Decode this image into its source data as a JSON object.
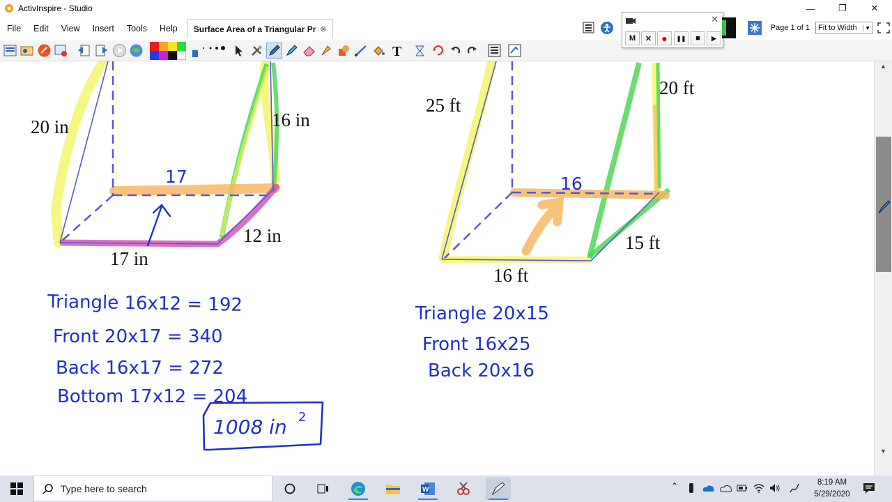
{
  "window": {
    "title": "ActivInspire - Studio",
    "minimize": "—",
    "restore": "❐",
    "close": "✕"
  },
  "menu": {
    "items": [
      "File",
      "Edit",
      "View",
      "Insert",
      "Tools",
      "Help"
    ],
    "doc_tab": "Surface Area of a Triangular Pr",
    "doc_tab_close": "⊗"
  },
  "page_nav": {
    "page": "Page 1 of 1",
    "zoom": "Fit to Width"
  },
  "recorder": {
    "buttons": [
      "M",
      "✕",
      "●",
      "❚❚",
      "■",
      "▶"
    ]
  },
  "figure_left": {
    "labels": {
      "slant": "20 in",
      "height": "16 in",
      "depth": "12 in",
      "base": "17 in"
    },
    "annotation": "17",
    "work": [
      "Triangle  16x12 = 192",
      "Front  20x17 = 340",
      "Back  16x17 = 272",
      "Bottom  17x12 = 204"
    ],
    "answer": "1008 in",
    "answer_exp": "2"
  },
  "figure_right": {
    "labels": {
      "slant": "25 ft",
      "height": "20 ft",
      "depth": "15 ft",
      "base": "16 ft"
    },
    "annotation": "16",
    "work": [
      "Triangle  20x15",
      "Front  16x25",
      "Back  20x16"
    ]
  },
  "taskbar": {
    "search_placeholder": "Type here to search",
    "time": "8:19 AM",
    "date": "5/29/2020"
  },
  "colors": {
    "ink_blue": "#1e2fd0",
    "dash_purple": "#5a55d8",
    "highlight_yellow": "#f3f35a",
    "highlight_green": "#44d64a",
    "highlight_orange": "#f5b45a",
    "highlight_magenta": "#cf4fb3"
  }
}
